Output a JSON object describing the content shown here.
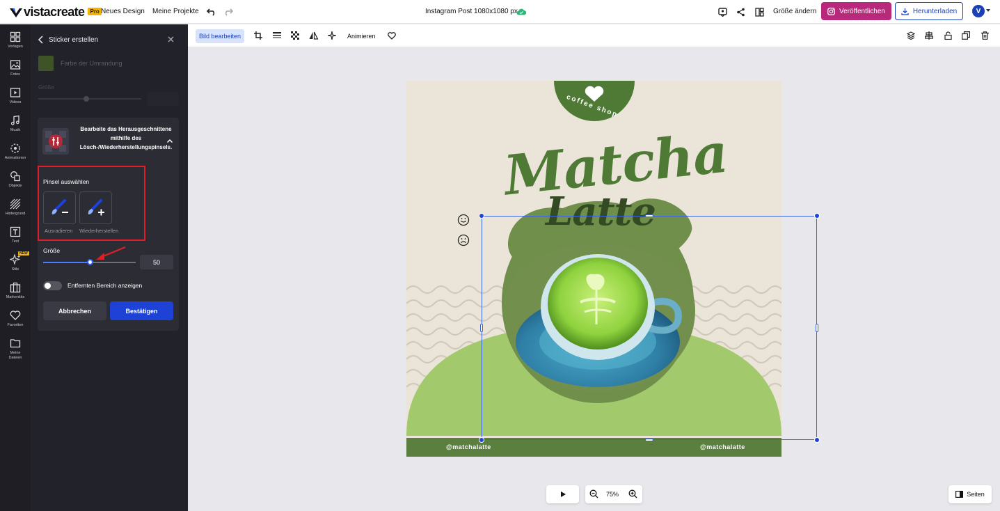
{
  "header": {
    "logo_text": "vistacreate",
    "pro_badge": "Pro",
    "new_design": "Neues Design",
    "my_projects": "Meine Projekte",
    "doc_title": "Instagram Post 1080x1080 px",
    "resize": "Größe ändern",
    "publish": "Veröffentlichen",
    "download": "Herunterladen",
    "avatar_initial": "V"
  },
  "rail": {
    "items": [
      {
        "label": "Vorlagen",
        "icon": "templates-icon"
      },
      {
        "label": "Fotos",
        "icon": "photos-icon"
      },
      {
        "label": "Videos",
        "icon": "videos-icon"
      },
      {
        "label": "Musik",
        "icon": "music-icon"
      },
      {
        "label": "Animationen",
        "icon": "animations-icon"
      },
      {
        "label": "Objekte",
        "icon": "objects-icon"
      },
      {
        "label": "Hintergrund",
        "icon": "background-icon"
      },
      {
        "label": "Text",
        "icon": "text-icon"
      },
      {
        "label": "Stile",
        "icon": "styles-icon"
      },
      {
        "label": "Markenkits",
        "icon": "brand-kits-icon"
      },
      {
        "label": "Favoriten",
        "icon": "favorites-icon"
      },
      {
        "label": "Meine Dateien",
        "icon": "my-files-icon"
      }
    ],
    "new_badge": "NEW"
  },
  "panel": {
    "title": "Sticker erstellen",
    "outline_color_label": "Farbe der Umrandung",
    "faded_size_label": "Größe",
    "card_description": "Bearbeite das Herausgeschnittene mithilfe des Lösch-/Wiederherstellungspinsels.",
    "brush_select_label": "Pinsel auswählen",
    "brush_erase": "Ausradieren",
    "brush_restore": "Wiederherstellen",
    "size_label": "Größe",
    "size_value": "50",
    "size_fraction": 0.5,
    "toggle_label": "Entfernten Bereich anzeigen",
    "cancel": "Abbrechen",
    "confirm": "Bestätigen"
  },
  "toolbar": {
    "edit_image": "Bild bearbeiten",
    "animate": "Animieren"
  },
  "artboard": {
    "badge_text": "coffee shop",
    "title_line1": "Matcha",
    "title_line2": "Latte",
    "handle_left": "@matchalatte",
    "handle_right": "@matchalatte"
  },
  "bottom": {
    "zoom": "75%",
    "pages": "Seiten"
  },
  "colors": {
    "publish": "#b8287b",
    "primary": "#1f42d6",
    "brand_green": "#4e7a35"
  }
}
